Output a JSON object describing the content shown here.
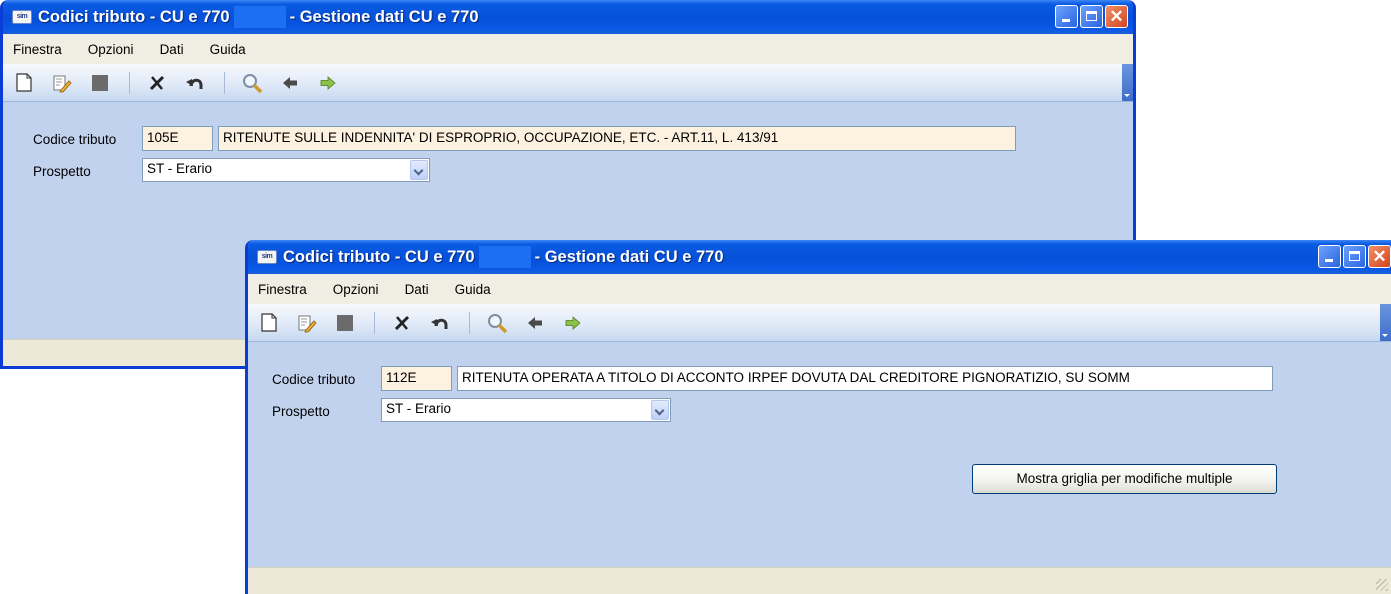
{
  "app_icon_text": "sim",
  "windows": [
    {
      "title_part1": "Codici tributo - CU e 770",
      "title_part2": "- Gestione dati CU e 770",
      "menu": [
        "Finestra",
        "Opzioni",
        "Dati",
        "Guida"
      ],
      "codice_label": "Codice tributo",
      "codice_value": "105E",
      "descrizione": "RITENUTE SULLE INDENNITA' DI ESPROPRIO, OCCUPAZIONE, ETC. - ART.11, L. 413/91",
      "prospetto_label": "Prospetto",
      "prospetto_value": "ST - Erario"
    },
    {
      "title_part1": "Codici tributo - CU e 770",
      "title_part2": "- Gestione dati CU e 770",
      "menu": [
        "Finestra",
        "Opzioni",
        "Dati",
        "Guida"
      ],
      "codice_label": "Codice tributo",
      "codice_value": "112E",
      "descrizione": "RITENUTA OPERATA A TITOLO DI ACCONTO IRPEF DOVUTA DAL CREDITORE PIGNORATIZIO, SU SOMM",
      "prospetto_label": "Prospetto",
      "prospetto_value": "ST - Erario",
      "button_label": "Mostra griglia per modifiche multiple"
    }
  ],
  "colors": {
    "titlebar": "#0650d8",
    "client_bg": "#c1d2ee",
    "menubar_bg": "#f0eee3",
    "field_highlight": "#fdf1e0"
  }
}
